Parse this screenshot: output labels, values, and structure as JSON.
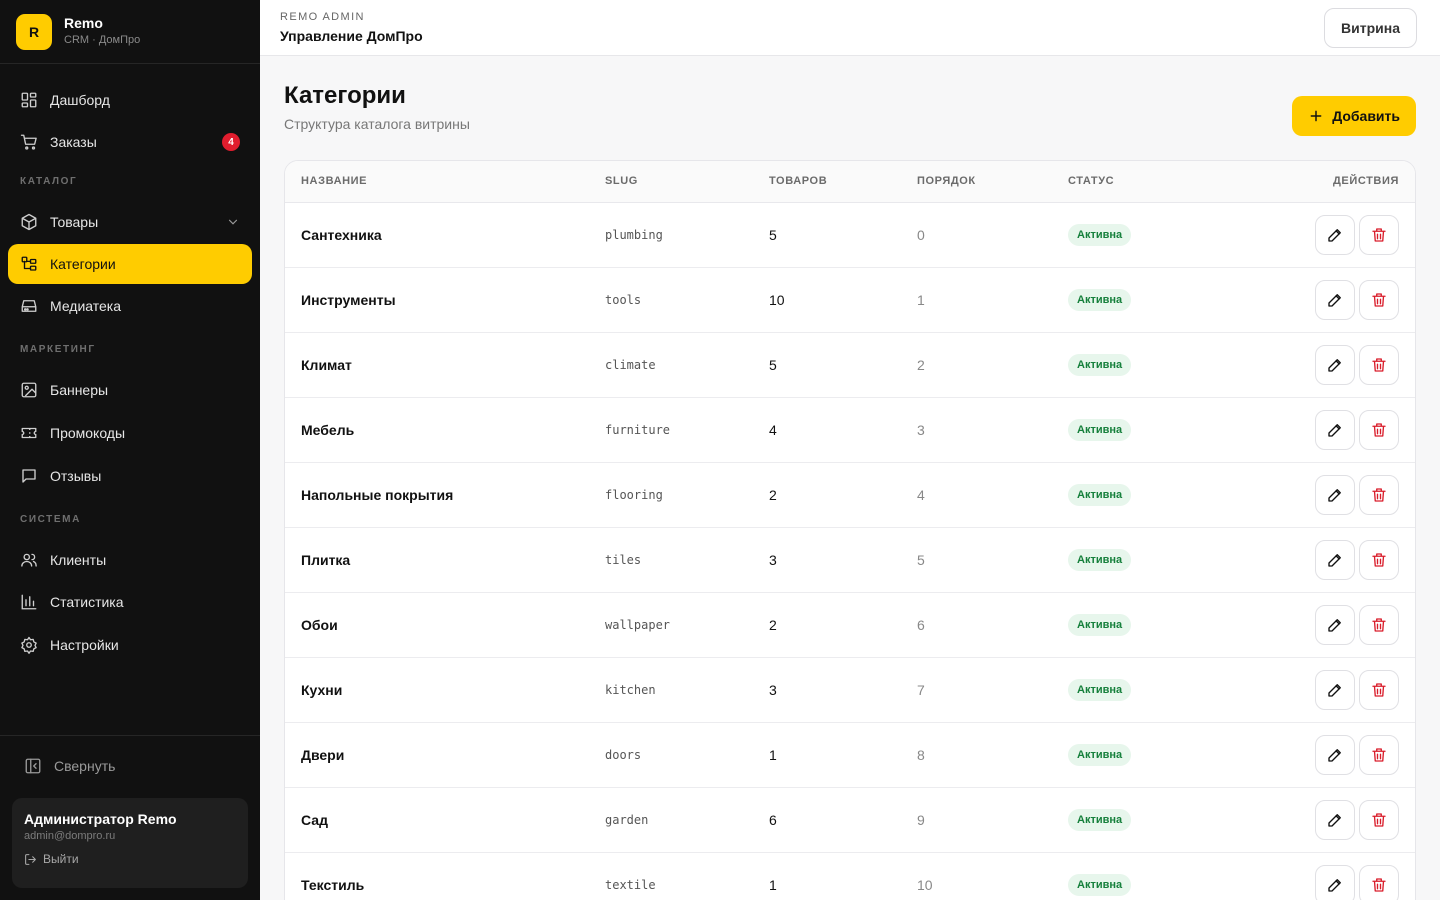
{
  "brand": {
    "logo_letter": "R",
    "name": "Remo",
    "subtitle": "CRM · ДомПро"
  },
  "nav": {
    "dashboard": "Дашборд",
    "orders": "Заказы",
    "orders_badge": "4",
    "catalog_label": "КАТАЛОГ",
    "products": "Товары",
    "categories": "Категории",
    "media": "Медиатека",
    "marketing_label": "МАРКЕТИНГ",
    "banners": "Баннеры",
    "promocodes": "Промокоды",
    "reviews": "Отзывы",
    "system_label": "СИСТЕМА",
    "clients": "Клиенты",
    "statistics": "Статистика",
    "settings": "Настройки"
  },
  "sidebar_footer": {
    "collapse": "Свернуть",
    "user_name": "Администратор Remo",
    "user_email": "admin@dompro.ru",
    "logout": "Выйти"
  },
  "topbar": {
    "kicker": "REMO ADMIN",
    "title": "Управление ДомПро",
    "storefront_button": "Витрина"
  },
  "page": {
    "title": "Категории",
    "subtitle": "Структура каталога витрины",
    "add_button": "Добавить"
  },
  "table": {
    "headers": {
      "name": "НАЗВАНИЕ",
      "slug": "SLUG",
      "products": "ТОВАРОВ",
      "order": "ПОРЯДОК",
      "status": "СТАТУС",
      "actions": "ДЕЙСТВИЯ"
    },
    "rows": [
      {
        "name": "Сантехника",
        "slug": "plumbing",
        "products": "5",
        "order": "0",
        "status": "Активна"
      },
      {
        "name": "Инструменты",
        "slug": "tools",
        "products": "10",
        "order": "1",
        "status": "Активна"
      },
      {
        "name": "Климат",
        "slug": "climate",
        "products": "5",
        "order": "2",
        "status": "Активна"
      },
      {
        "name": "Мебель",
        "slug": "furniture",
        "products": "4",
        "order": "3",
        "status": "Активна"
      },
      {
        "name": "Напольные покрытия",
        "slug": "flooring",
        "products": "2",
        "order": "4",
        "status": "Активна"
      },
      {
        "name": "Плитка",
        "slug": "tiles",
        "products": "3",
        "order": "5",
        "status": "Активна"
      },
      {
        "name": "Обои",
        "slug": "wallpaper",
        "products": "2",
        "order": "6",
        "status": "Активна"
      },
      {
        "name": "Кухни",
        "slug": "kitchen",
        "products": "3",
        "order": "7",
        "status": "Активна"
      },
      {
        "name": "Двери",
        "slug": "doors",
        "products": "1",
        "order": "8",
        "status": "Активна"
      },
      {
        "name": "Сад",
        "slug": "garden",
        "products": "6",
        "order": "9",
        "status": "Активна"
      },
      {
        "name": "Текстиль",
        "slug": "textile",
        "products": "1",
        "order": "10",
        "status": "Активна"
      }
    ]
  },
  "colors": {
    "accent": "#ffcc00",
    "sidebar_bg": "#111111",
    "danger": "#d91c2a",
    "success": "#16803c"
  }
}
